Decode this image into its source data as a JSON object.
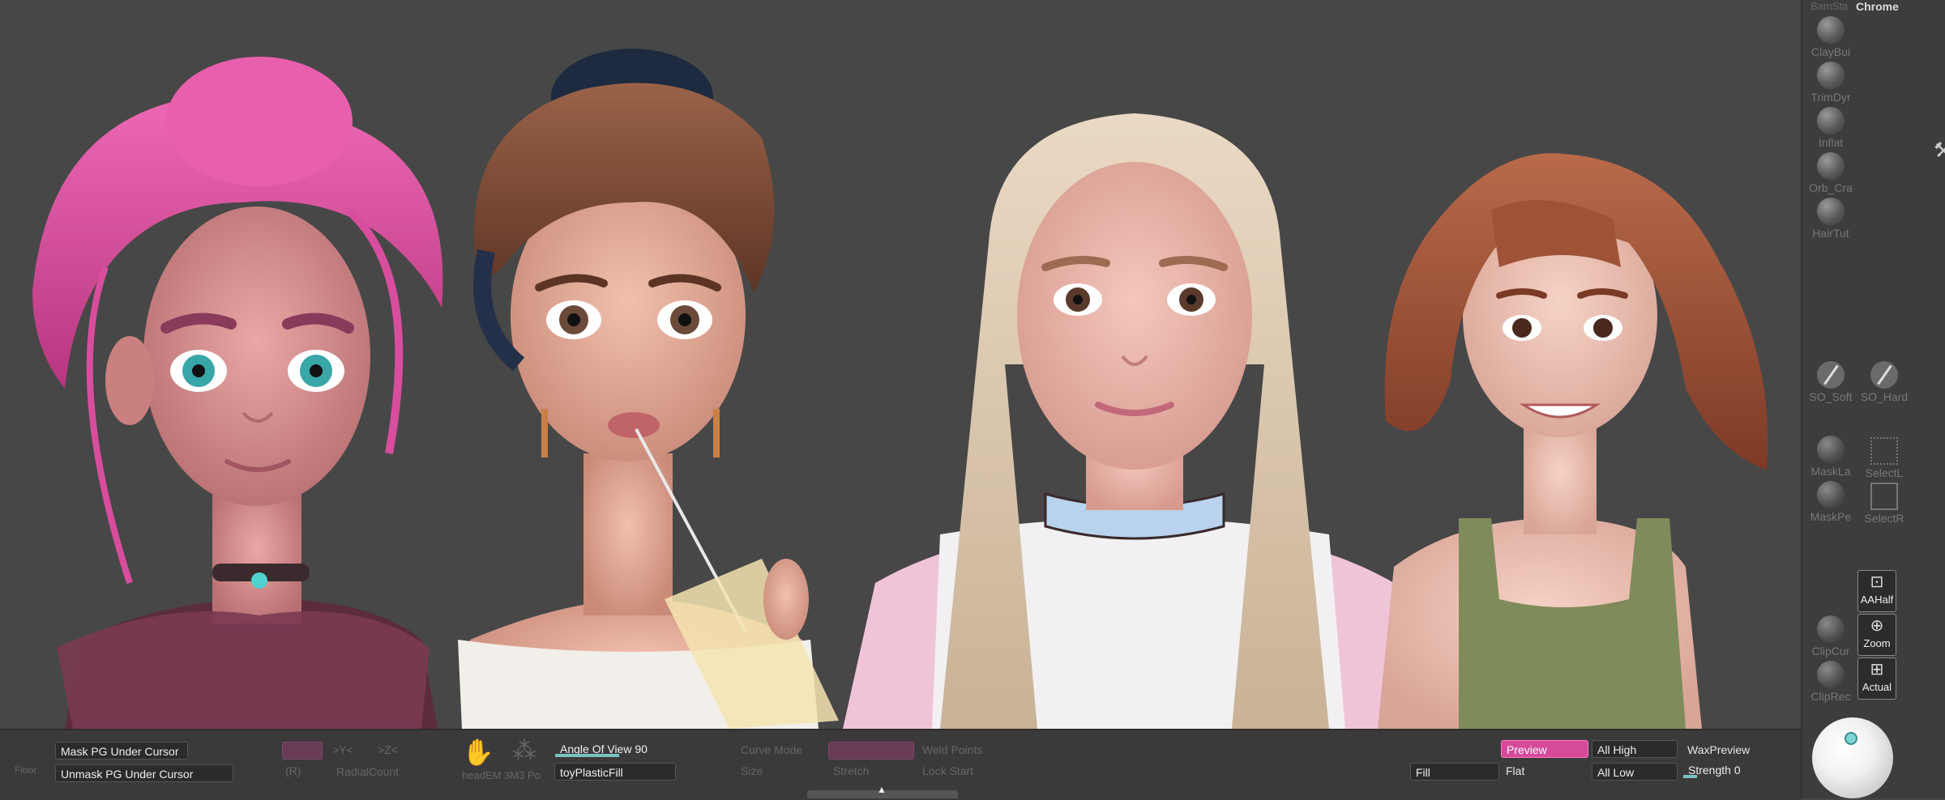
{
  "viewport": {
    "background": "#474747"
  },
  "right_shelf": {
    "partial_top_label": "BamSta",
    "header_label": "Chrome",
    "brushes": [
      {
        "label": "ClayBui",
        "icon": "clay-buildup-brush-icon"
      },
      {
        "label": "TrimDyr",
        "icon": "trim-dynamic-brush-icon"
      },
      {
        "label": "Inflat",
        "icon": "inflate-brush-icon"
      },
      {
        "label": "Orb_Cra",
        "icon": "orb-cracks-brush-icon"
      },
      {
        "label": "HairTut",
        "icon": "hair-tubes-brush-icon"
      },
      {
        "label": "SO_Soft",
        "icon": "soft-brush-icon"
      },
      {
        "label": "SO_Hard",
        "icon": "hard-brush-icon"
      },
      {
        "label": "MaskLa",
        "icon": "mask-lasso-icon"
      },
      {
        "label": "SelectL",
        "icon": "select-lasso-icon"
      },
      {
        "label": "MaskPe",
        "icon": "mask-pen-icon"
      },
      {
        "label": "SelectR",
        "icon": "select-rect-icon"
      },
      {
        "label": "ClipCur",
        "icon": "clip-curve-icon"
      },
      {
        "label": "ClipRec",
        "icon": "clip-rect-icon"
      }
    ],
    "nav_buttons": [
      {
        "label": "AAHalf",
        "icon": "aahalf-icon"
      },
      {
        "label": "Zoom",
        "icon": "zoom-icon"
      },
      {
        "label": "Actual",
        "icon": "actual-size-icon"
      }
    ],
    "material_ball_icon": "material-preview-sphere-icon"
  },
  "bottom_bar": {
    "floor_label": "Floor",
    "mask_pg_under_cursor": "Mask PG Under Cursor",
    "unmask_pg_under_cursor": "Unmask PG Under Cursor",
    "faded_xyz_a": "",
    "faded_y": ">Y<",
    "faded_z": ">Z<",
    "faded_r": "(R)",
    "radial_count": "RadialCount",
    "brush_name": "headEM 3M3 Po",
    "angle_of_view_label": "Angle Of View",
    "angle_of_view_value": "90",
    "angle_of_view_fraction": 0.5,
    "material_name": "toyPlasticFill",
    "curve_mode": "Curve Mode",
    "size_label": "Size",
    "stretch_label": "Stretch",
    "weld_points": "Weld Points",
    "lock_start": "Lock Start",
    "fill_button": "Fill",
    "preview_button": "Preview",
    "flat_label": "Flat",
    "all_high": "All High",
    "all_low": "All Low",
    "wax_preview": "WaxPreview",
    "strength_label": "Strength",
    "strength_value": "0",
    "strength_fraction": 0.0
  },
  "colors": {
    "accent_pink": "#d64a9a",
    "slider_teal": "#7ac2c2",
    "panel_dark": "#3a3a3a"
  }
}
